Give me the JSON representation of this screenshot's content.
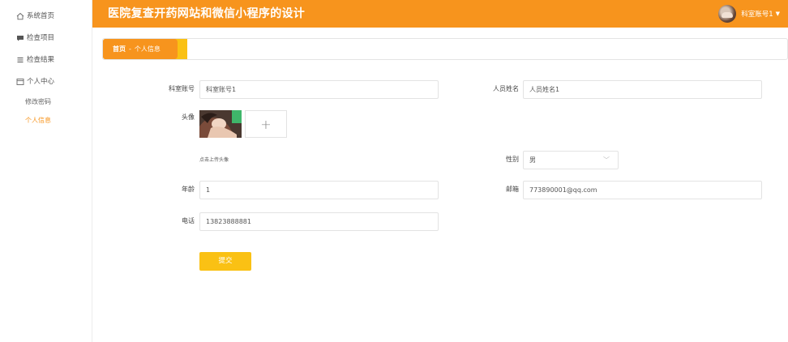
{
  "sidebar": {
    "items": [
      {
        "label": "系统首页",
        "icon": "home-icon"
      },
      {
        "label": "检查项目",
        "icon": "comment-icon"
      },
      {
        "label": "检查结果",
        "icon": "list-icon"
      },
      {
        "label": "个人中心",
        "icon": "window-icon"
      }
    ],
    "subitems": [
      {
        "label": "修改密码"
      },
      {
        "label": "个人信息",
        "active": true
      }
    ]
  },
  "header": {
    "title": "医院复查开药网站和微信小程序的设计",
    "user_name": "科室账号1",
    "accent": "#f7941d"
  },
  "breadcrumb": {
    "home": "首页",
    "separator": "-",
    "current": "个人信息",
    "accent": "#f7941d",
    "accent2": "#fac114"
  },
  "form": {
    "account_label": "科室账号",
    "account_value": "科室账号1",
    "staff_name_label": "人员姓名",
    "staff_name_value": "人员姓名1",
    "avatar_label": "头像",
    "upload_symbol": "+",
    "upload_hint": "点击上传头像",
    "gender_label": "性别",
    "gender_value": "男",
    "age_label": "年龄",
    "age_value": "1",
    "email_label": "邮箱",
    "email_value": "773890001@qq.com",
    "phone_label": "电话",
    "phone_value": "13823888881",
    "submit_label": "提交"
  }
}
